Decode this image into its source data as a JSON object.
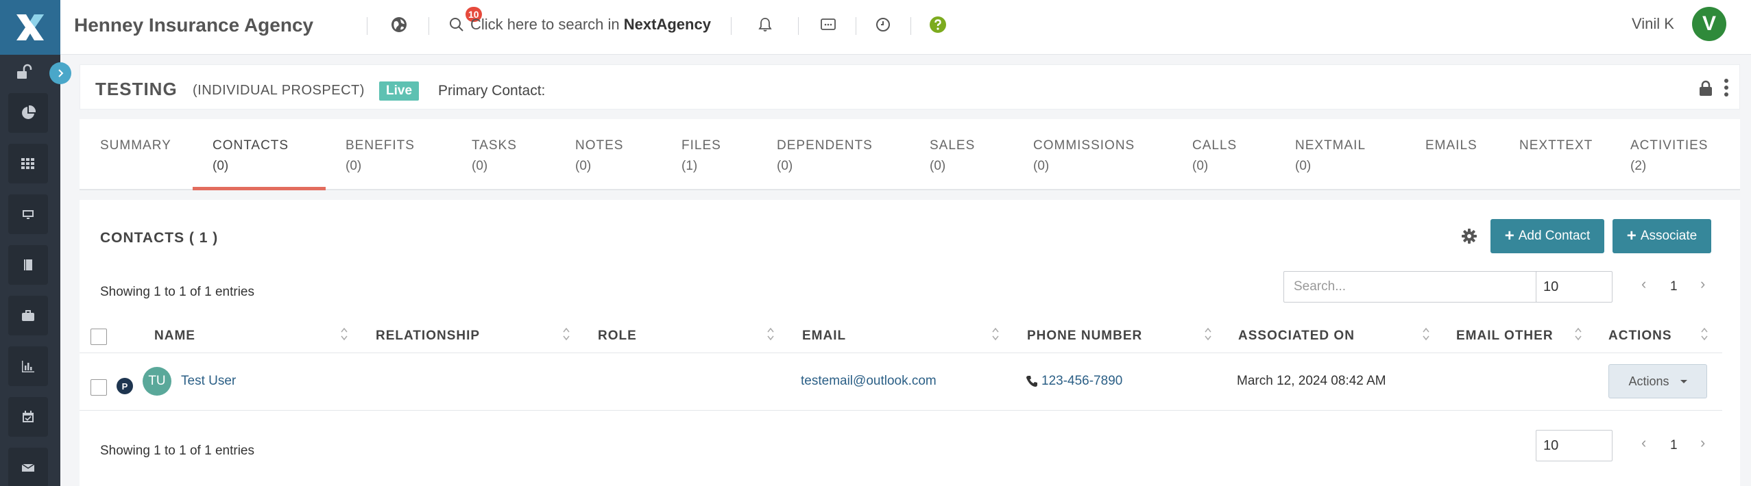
{
  "app": {
    "title": "Henney Insurance Agency",
    "notification_count": "10",
    "search_prefix": "Click here to search in",
    "search_brand": "NextAgency",
    "user_name": "Vinil K",
    "user_initial": "V"
  },
  "record": {
    "name": "TESTING",
    "type": "(INDIVIDUAL PROSPECT)",
    "status": "Live",
    "primary_contact_label": "Primary Contact:"
  },
  "tabs": [
    {
      "label": "SUMMARY",
      "count": ""
    },
    {
      "label": "CONTACTS",
      "count": "(0)"
    },
    {
      "label": "BENEFITS",
      "count": "(0)"
    },
    {
      "label": "TASKS",
      "count": "(0)"
    },
    {
      "label": "NOTES",
      "count": "(0)"
    },
    {
      "label": "FILES",
      "count": "(1)"
    },
    {
      "label": "DEPENDENTS",
      "count": "(0)"
    },
    {
      "label": "SALES",
      "count": "(0)"
    },
    {
      "label": "COMMISSIONS",
      "count": "(0)"
    },
    {
      "label": "CALLS",
      "count": "(0)"
    },
    {
      "label": "NEXTMAIL",
      "count": "(0)"
    },
    {
      "label": "EMAILS",
      "count": ""
    },
    {
      "label": "NEXTTEXT",
      "count": ""
    },
    {
      "label": "ACTIVITIES",
      "count": "(2)"
    }
  ],
  "active_tab": "CONTACTS",
  "contacts": {
    "title": "CONTACTS ( 1 )",
    "add_label": "Add Contact",
    "associate_label": "Associate",
    "showing_top": "Showing 1 to 1 of 1 entries",
    "showing_bottom": "Showing 1 to 1 of 1 entries",
    "search_placeholder": "Search...",
    "page_size": "10",
    "page": "1",
    "columns": [
      "NAME",
      "RELATIONSHIP",
      "ROLE",
      "EMAIL",
      "PHONE NUMBER",
      "ASSOCIATED ON",
      "EMAIL OTHER",
      "ACTIONS"
    ],
    "rows": [
      {
        "badge": "P",
        "initials": "TU",
        "name": "Test User",
        "relationship": "",
        "role": "",
        "email": "testemail@outlook.com",
        "phone": "123-456-7890",
        "associated_on": "March 12, 2024 08:42 AM",
        "email_other": "",
        "actions_label": "Actions"
      }
    ]
  },
  "colors": {
    "sidebar": "#2d3540",
    "logo_bg": "#2c6b93",
    "primary_button": "#36879a",
    "live_badge": "#5ec1b2",
    "active_tab_underline": "#e26c5e",
    "avatar_green": "#2f8a3a",
    "help_icon": "#7cab1e",
    "notification_badge": "#e64a3c"
  },
  "icons": {
    "sidebar": [
      "unlock-icon",
      "pie-chart-icon",
      "grid-icon",
      "monitor-icon",
      "book-icon",
      "briefcase-icon",
      "bar-chart-icon",
      "calendar-check-icon",
      "mail-icon"
    ],
    "topbar": [
      "globe-icon",
      "search-icon",
      "bell-icon",
      "message-icon",
      "clock-icon",
      "help-icon"
    ]
  }
}
